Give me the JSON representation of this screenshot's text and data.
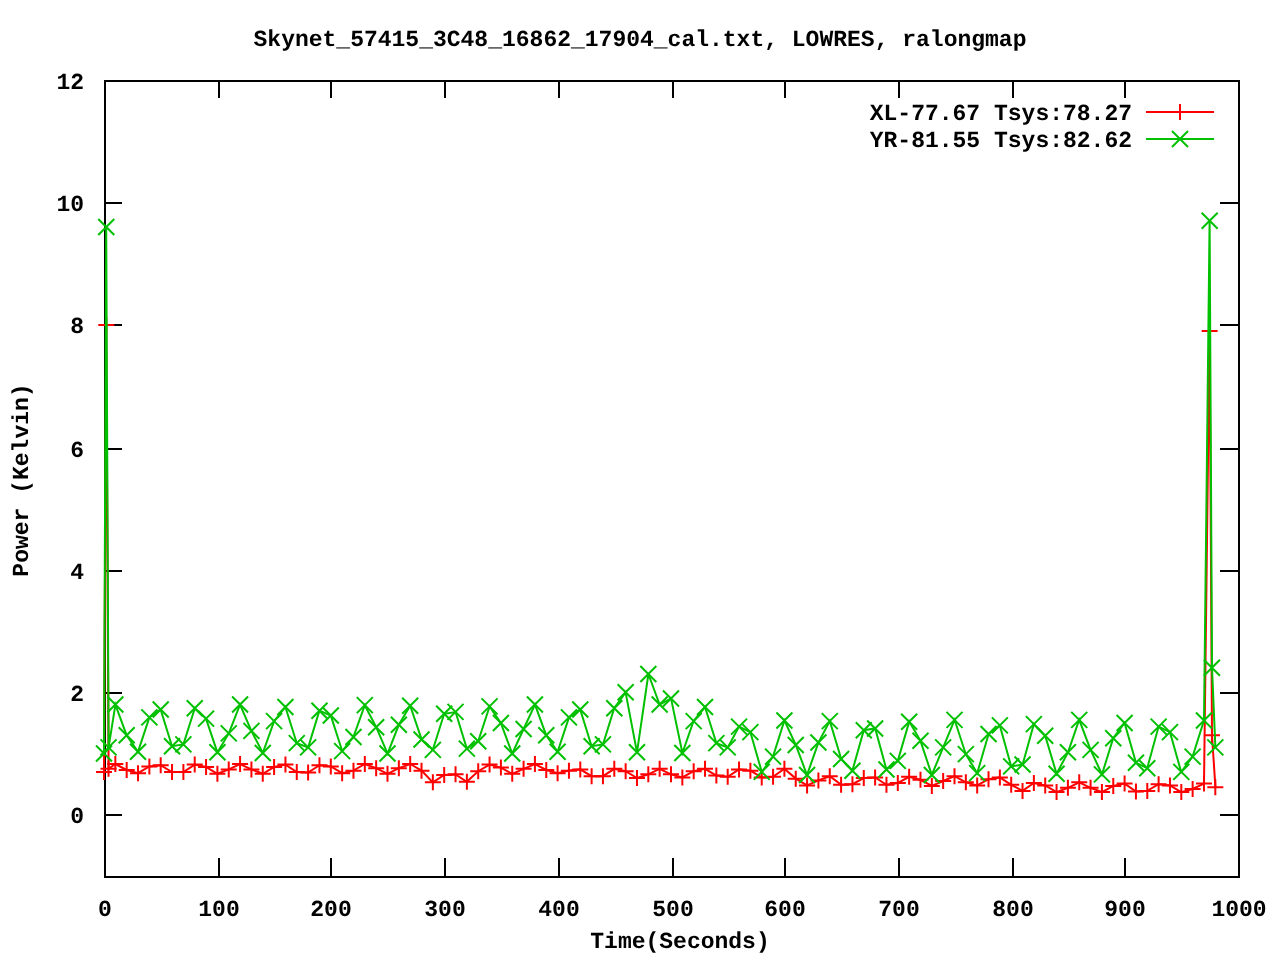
{
  "chart_data": {
    "type": "line",
    "title": "Skynet_57415_3C48_16862_17904_cal.txt, LOWRES, ralongmap",
    "xlabel": "Time(Seconds)",
    "ylabel": "Power (Kelvin)",
    "xlim": [
      0,
      1000
    ],
    "ylim": [
      -1,
      12
    ],
    "xticks": [
      0,
      100,
      200,
      300,
      400,
      500,
      600,
      700,
      800,
      900,
      1000
    ],
    "yticks": [
      0,
      2,
      4,
      6,
      8,
      10,
      12
    ],
    "legend": true,
    "x": [
      0,
      2,
      4,
      10,
      20,
      30,
      40,
      50,
      60,
      70,
      80,
      90,
      100,
      110,
      120,
      130,
      140,
      150,
      160,
      170,
      180,
      190,
      200,
      210,
      220,
      230,
      240,
      250,
      260,
      270,
      280,
      290,
      300,
      310,
      320,
      330,
      340,
      350,
      360,
      370,
      380,
      390,
      400,
      410,
      420,
      430,
      440,
      450,
      460,
      470,
      480,
      490,
      500,
      510,
      520,
      530,
      540,
      550,
      560,
      570,
      580,
      590,
      600,
      610,
      620,
      630,
      640,
      650,
      660,
      670,
      680,
      690,
      700,
      710,
      720,
      730,
      740,
      750,
      760,
      770,
      780,
      790,
      800,
      810,
      820,
      830,
      840,
      850,
      860,
      870,
      880,
      890,
      900,
      910,
      920,
      930,
      940,
      950,
      960,
      970,
      975,
      977,
      980
    ],
    "series": [
      {
        "name": "XL-77.67 Tsys:78.27",
        "color": "#ff0000",
        "marker": "plus",
        "values": [
          0.7,
          8.0,
          0.75,
          0.83,
          0.73,
          0.68,
          0.79,
          0.81,
          0.7,
          0.7,
          0.82,
          0.78,
          0.67,
          0.74,
          0.83,
          0.74,
          0.67,
          0.78,
          0.82,
          0.7,
          0.69,
          0.81,
          0.79,
          0.68,
          0.72,
          0.83,
          0.76,
          0.67,
          0.76,
          0.83,
          0.72,
          0.53,
          0.65,
          0.66,
          0.54,
          0.71,
          0.82,
          0.77,
          0.67,
          0.75,
          0.83,
          0.73,
          0.68,
          0.72,
          0.74,
          0.63,
          0.63,
          0.75,
          0.71,
          0.6,
          0.66,
          0.75,
          0.66,
          0.61,
          0.71,
          0.75,
          0.64,
          0.62,
          0.74,
          0.72,
          0.61,
          0.62,
          0.75,
          0.59,
          0.48,
          0.56,
          0.63,
          0.49,
          0.5,
          0.6,
          0.61,
          0.49,
          0.52,
          0.62,
          0.57,
          0.47,
          0.55,
          0.63,
          0.53,
          0.48,
          0.58,
          0.61,
          0.49,
          0.39,
          0.52,
          0.48,
          0.37,
          0.44,
          0.53,
          0.44,
          0.37,
          0.47,
          0.51,
          0.38,
          0.39,
          0.5,
          0.48,
          0.37,
          0.42,
          0.51,
          7.9,
          1.3,
          0.45
        ]
      },
      {
        "name": "YR-81.55 Tsys:82.62",
        "color": "#00c000",
        "marker": "cross",
        "values": [
          1.0,
          9.6,
          1.1,
          1.8,
          1.3,
          1.03,
          1.59,
          1.72,
          1.12,
          1.15,
          1.74,
          1.57,
          1.02,
          1.33,
          1.8,
          1.37,
          1.01,
          1.53,
          1.76,
          1.17,
          1.1,
          1.7,
          1.62,
          1.04,
          1.27,
          1.79,
          1.43,
          1.0,
          1.47,
          1.78,
          1.23,
          1.06,
          1.65,
          1.68,
          1.08,
          1.2,
          1.77,
          1.5,
          1.0,
          1.4,
          1.8,
          1.3,
          1.03,
          1.59,
          1.72,
          1.12,
          1.15,
          1.74,
          2.0,
          1.02,
          2.3,
          1.8,
          1.9,
          1.01,
          1.53,
          1.76,
          1.17,
          1.1,
          1.44,
          1.35,
          0.7,
          0.95,
          1.54,
          1.14,
          0.65,
          1.18,
          1.53,
          0.91,
          0.72,
          1.38,
          1.41,
          0.74,
          0.88,
          1.52,
          1.21,
          0.65,
          1.1,
          1.55,
          0.99,
          0.68,
          1.32,
          1.46,
          0.79,
          0.82,
          1.48,
          1.29,
          0.67,
          1.02,
          1.55,
          1.06,
          0.66,
          1.25,
          1.5,
          0.85,
          0.76,
          1.44,
          1.35,
          0.7,
          0.95,
          1.54,
          9.7,
          2.4,
          1.1
        ]
      }
    ]
  }
}
